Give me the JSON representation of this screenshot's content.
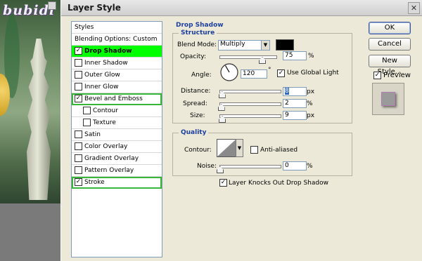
{
  "artwork": {
    "brand": "bubidi"
  },
  "dialog": {
    "title": "Layer Style",
    "close_glyph": "✕"
  },
  "styles_list": {
    "header": "Styles",
    "blending": "Blending Options: Custom",
    "items": [
      {
        "label": "Drop Shadow",
        "checked": true
      },
      {
        "label": "Inner Shadow",
        "checked": false
      },
      {
        "label": "Outer Glow",
        "checked": false
      },
      {
        "label": "Inner Glow",
        "checked": false
      },
      {
        "label": "Bevel and Emboss",
        "checked": true
      },
      {
        "label": "Contour",
        "checked": false
      },
      {
        "label": "Texture",
        "checked": false
      },
      {
        "label": "Satin",
        "checked": false
      },
      {
        "label": "Color Overlay",
        "checked": false
      },
      {
        "label": "Gradient Overlay",
        "checked": false
      },
      {
        "label": "Pattern Overlay",
        "checked": false
      },
      {
        "label": "Stroke",
        "checked": true
      }
    ],
    "check_glyph": "✓"
  },
  "drop_shadow": {
    "title": "Drop Shadow",
    "structure": {
      "title": "Structure",
      "blend_mode_label": "Blend Mode:",
      "blend_mode_value": "Multiply",
      "shadow_color": "#000000",
      "opacity_label": "Opacity:",
      "opacity_value": "75",
      "opacity_unit": "%",
      "angle_label": "Angle:",
      "angle_value": "120",
      "angle_unit": "°",
      "use_global_light_label": "Use Global Light",
      "use_global_light": true,
      "distance_label": "Distance:",
      "distance_value": "8",
      "distance_unit": "px",
      "spread_label": "Spread:",
      "spread_value": "2",
      "spread_unit": "%",
      "size_label": "Size:",
      "size_value": "9",
      "size_unit": "px"
    },
    "quality": {
      "title": "Quality",
      "contour_label": "Contour:",
      "anti_aliased_label": "Anti-aliased",
      "noise_label": "Noise:",
      "noise_value": "0",
      "noise_unit": "%"
    },
    "knockout_label": "Layer Knocks Out Drop Shadow"
  },
  "buttons": {
    "ok": "OK",
    "cancel": "Cancel",
    "new_style": "New Style...",
    "preview_label": "Preview"
  },
  "colors": {
    "selected_row": "#00ff00",
    "highlight_outline": "#38b83a",
    "group_title": "#1c3fa0"
  }
}
